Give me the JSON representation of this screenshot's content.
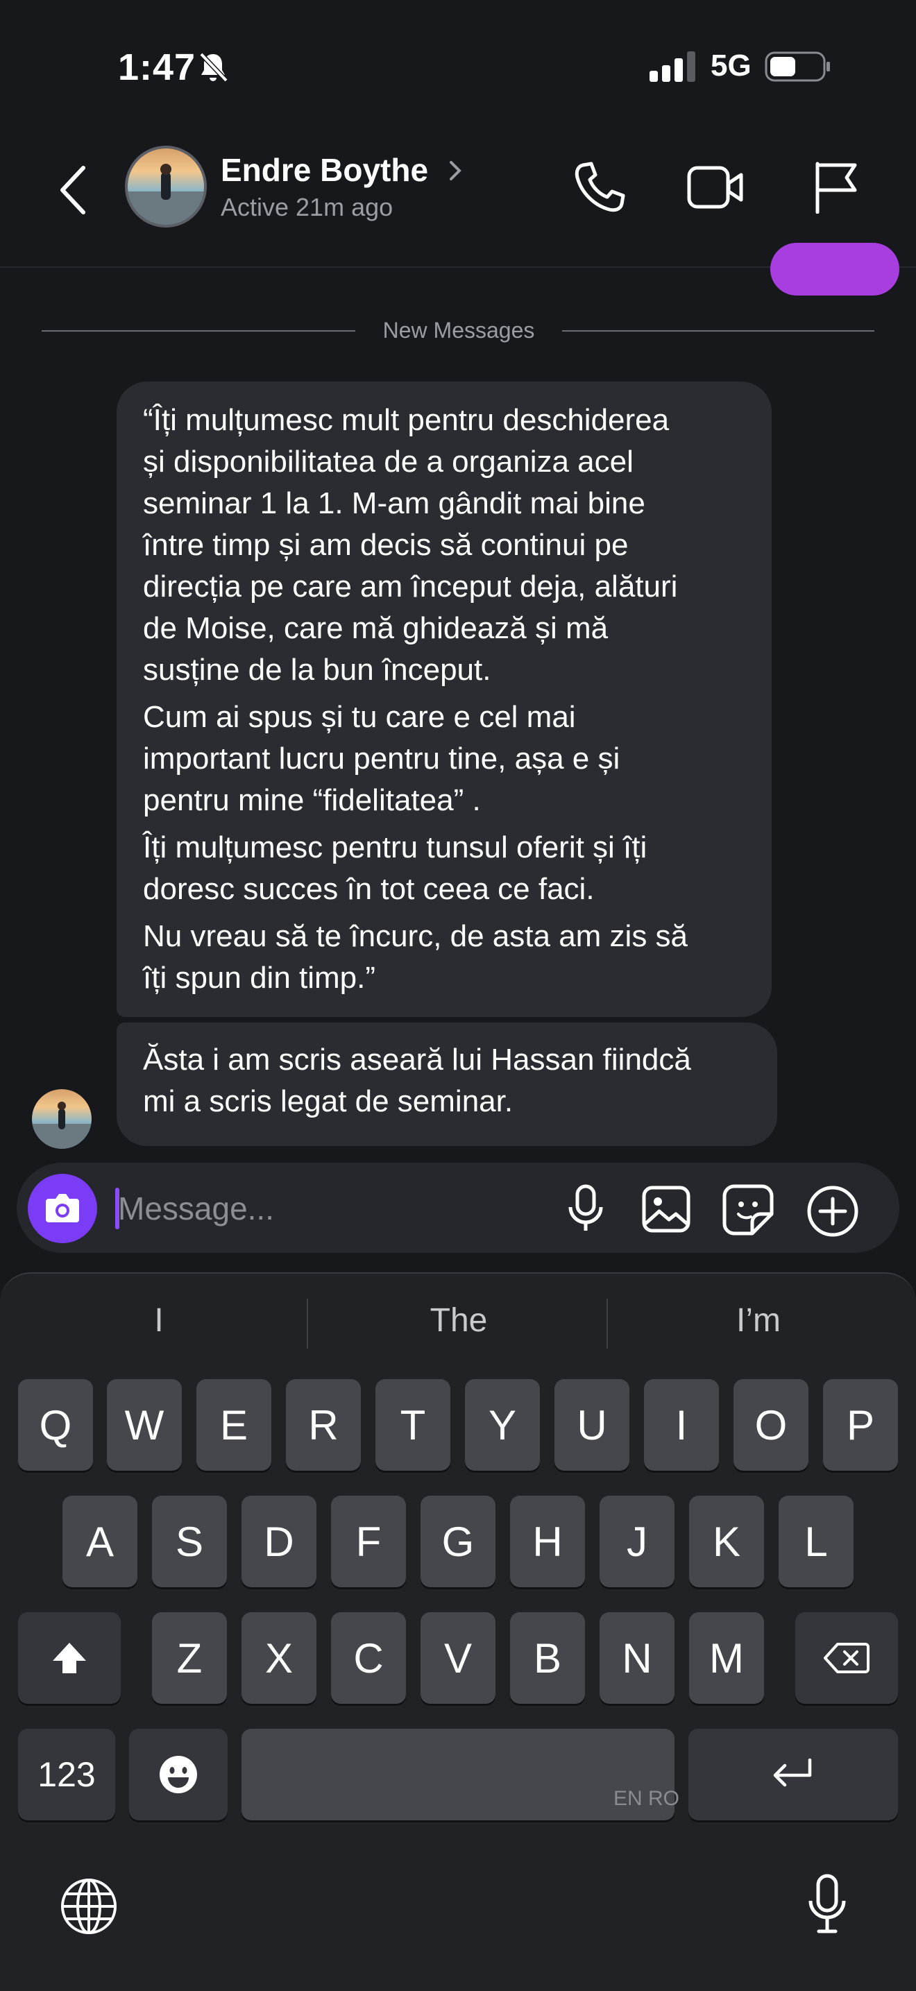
{
  "status_bar": {
    "time": "1:47",
    "network": "5G",
    "icons": [
      "bell-slash-icon",
      "signal-icon",
      "battery-icon"
    ]
  },
  "header": {
    "contact_name": "Endre Boythe",
    "status": "Active 21m ago",
    "icons": [
      "back-chevron-icon",
      "chevron-right-icon",
      "phone-icon",
      "video-icon",
      "flag-icon"
    ]
  },
  "messages": {
    "divider_label": "New Messages",
    "received": [
      {
        "paragraphs": [
          "“Îți mulțumesc mult pentru deschiderea\nși disponibilitatea de a organiza acel\nseminar 1 la 1. M-am gândit mai bine\nîntre timp și am decis să continui pe\ndirecția pe care am început deja, alături\nde Moise, care mă ghidează și mă\nsusține de la bun început.",
          "Cum ai spus și tu care e cel mai\nimportant lucru pentru tine, așa e și\npentru mine “fidelitatea” .",
          "Îți mulțumesc pentru tunsul oferit și îți\ndoresc succes în tot ceea ce faci.",
          "Nu vreau să te încurc, de asta am zis să\nîți spun din timp.”"
        ]
      },
      {
        "text": "Ăsta i am scris aseară lui Hassan fiindcă\nmi a scris legat de seminar."
      }
    ]
  },
  "composer": {
    "placeholder": "Message...",
    "icons": [
      "camera-icon",
      "microphone-icon",
      "gallery-icon",
      "sticker-icon",
      "plus-icon"
    ]
  },
  "keyboard": {
    "suggestions": [
      "I",
      "The",
      "I’m"
    ],
    "row1": [
      "Q",
      "W",
      "E",
      "R",
      "T",
      "Y",
      "U",
      "I",
      "O",
      "P"
    ],
    "row2": [
      "A",
      "S",
      "D",
      "F",
      "G",
      "H",
      "J",
      "K",
      "L"
    ],
    "row3": [
      "Z",
      "X",
      "C",
      "V",
      "B",
      "N",
      "M"
    ],
    "numbers_label": "123",
    "space_languages": "EN RO",
    "icons": [
      "shift-icon",
      "backspace-icon",
      "emoji-icon",
      "return-icon",
      "globe-icon",
      "dictation-icon"
    ]
  },
  "colors": {
    "background": "#17181c",
    "bubble": "#2b2c31",
    "accent_purple": "#7a3cf5",
    "sent_bubble": "#a93ee0"
  }
}
